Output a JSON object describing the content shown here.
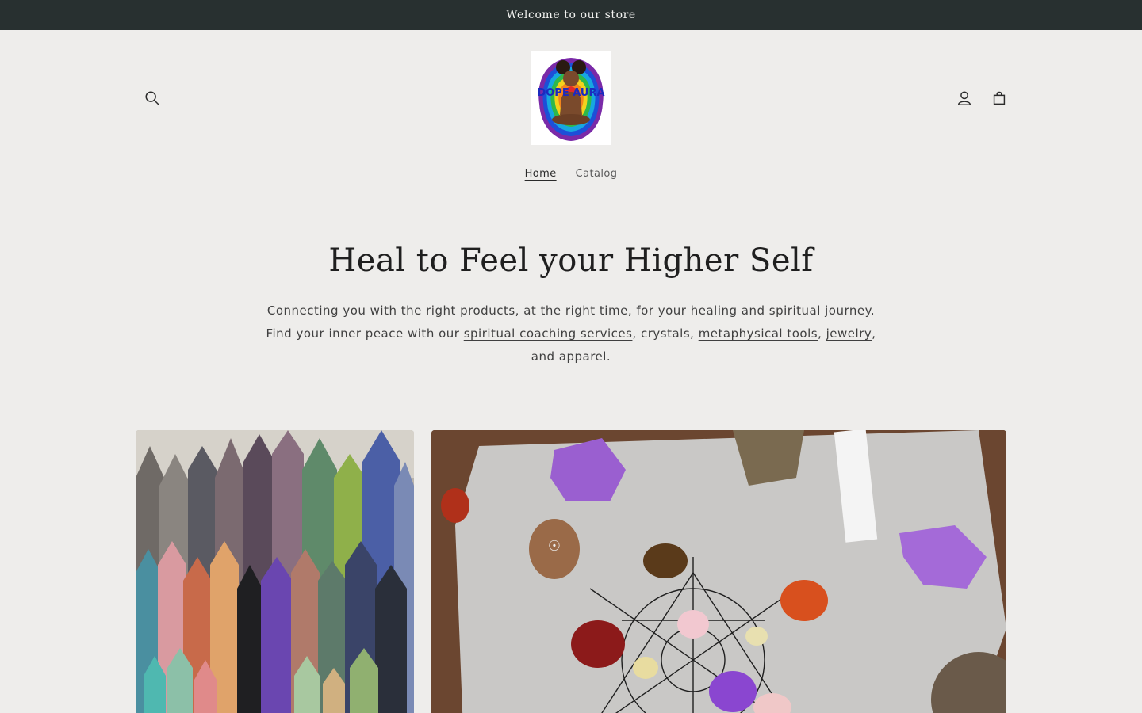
{
  "announcement": {
    "text": "Welcome to our store"
  },
  "header": {
    "search_icon": "search-icon",
    "account_icon": "account-icon",
    "cart_icon": "cart-icon",
    "logo_text": "DOPE AURA"
  },
  "nav": {
    "items": [
      {
        "label": "Home",
        "active": true
      },
      {
        "label": "Catalog",
        "active": false
      }
    ]
  },
  "hero": {
    "title": "Heal to Feel your Higher Self",
    "text_part1": "Connecting you with the right products, at the right time, for your healing and spiritual journey. Find your inner peace with our ",
    "link_coaching": "spiritual coaching services",
    "text_part2": ", crystals, ",
    "link_tools": "metaphysical tools",
    "text_part3": ", ",
    "link_jewelry": "jewelry",
    "text_part4": ", and apparel."
  },
  "colors": {
    "background": "#eeedeb",
    "announcement_bg": "#283030",
    "text": "#2a2a2a"
  }
}
